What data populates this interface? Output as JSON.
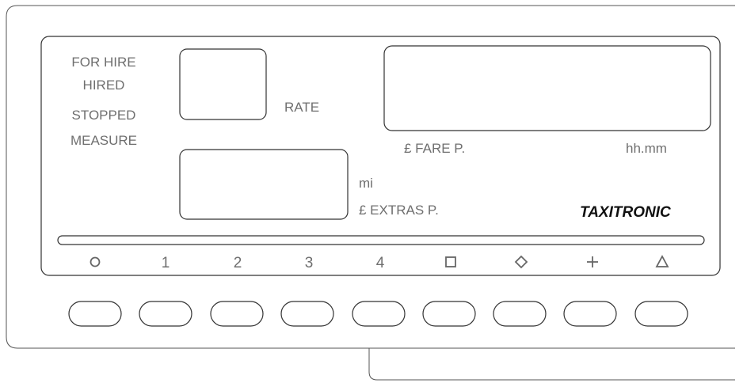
{
  "status_labels": [
    "FOR HIRE",
    "HIRED",
    "STOPPED",
    "MEASURE"
  ],
  "rate_label": "RATE",
  "fare_label": "£ FARE P.",
  "time_label": "hh.mm",
  "distance_unit": "mi",
  "extras_label": "£ EXTRAS P.",
  "brand": "TAXITRONIC",
  "key_labels": [
    {
      "id": "0",
      "icon": "circle-icon"
    },
    {
      "id": "1",
      "text": "1"
    },
    {
      "id": "2",
      "text": "2"
    },
    {
      "id": "3",
      "text": "3"
    },
    {
      "id": "4",
      "text": "4"
    },
    {
      "id": "square",
      "icon": "square-icon"
    },
    {
      "id": "diamond",
      "icon": "diamond-icon"
    },
    {
      "id": "plus",
      "icon": "plus-icon"
    },
    {
      "id": "triangle",
      "icon": "triangle-icon"
    }
  ],
  "button_count": 9
}
